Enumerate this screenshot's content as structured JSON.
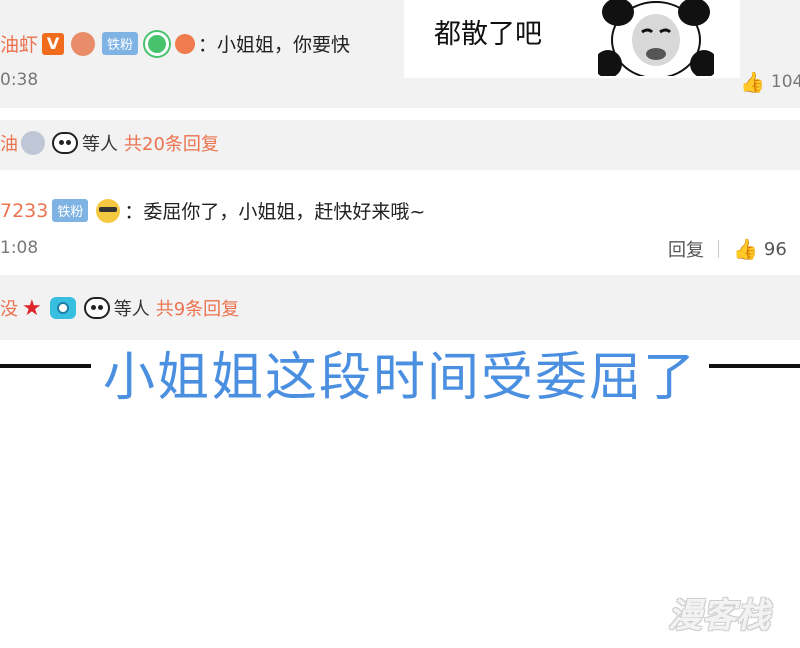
{
  "comment1": {
    "user": "油虾",
    "fan_badge": "铁粉",
    "text": "小姐姐，你要快",
    "time": "0:38",
    "like_count": "104"
  },
  "sticker": {
    "text": "都散了吧"
  },
  "replies1": {
    "user": "油",
    "suffix": "等人",
    "count": "共20条回复"
  },
  "comment2": {
    "user": "7233",
    "fan_badge": "铁粉",
    "text": "委屈你了，小姐姐，赶快好来哦~",
    "time": "1:08",
    "reply_label": "回复",
    "like_count": "96"
  },
  "replies2": {
    "user": "没",
    "suffix": "等人",
    "count": "共9条回复"
  },
  "caption": "小姐姐这段时间受委屈了",
  "watermark": "漫客栈",
  "colors": {
    "username": "#eb7350",
    "caption": "#4b8fe0",
    "fan_badge": "#7fb3e3"
  }
}
